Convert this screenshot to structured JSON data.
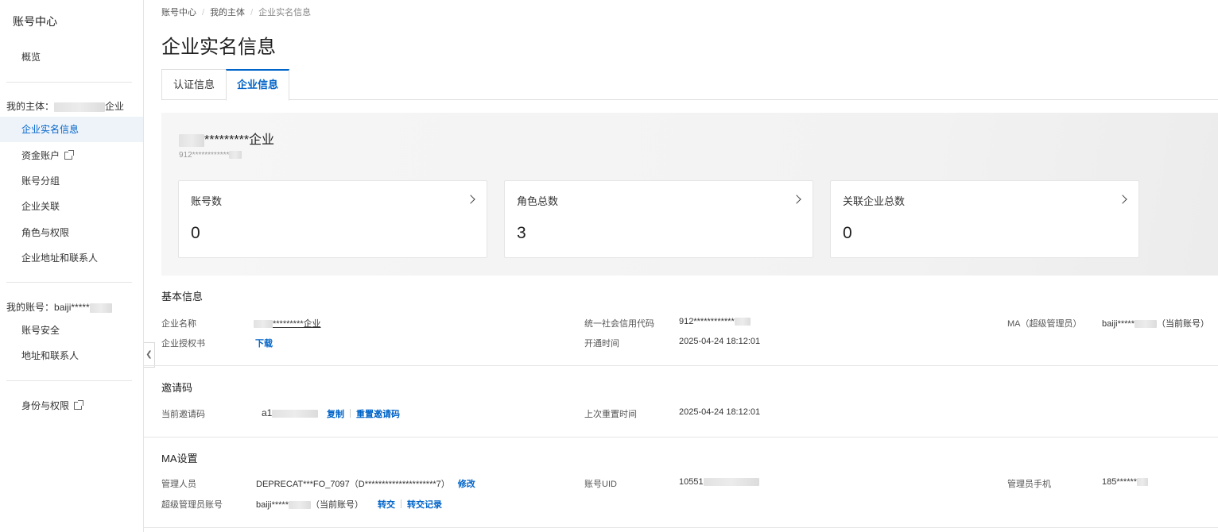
{
  "sidebar": {
    "title": "账号中心",
    "overview": "概览",
    "my_entity_label": "我的主体：",
    "my_entity_suffix": "企业",
    "entity_items": [
      "企业实名信息",
      "资金账户",
      "账号分组",
      "企业关联",
      "角色与权限",
      "企业地址和联系人"
    ],
    "my_account_label": "我的账号：",
    "my_account_value": "baiji*****",
    "account_items": [
      "账号安全",
      "地址和联系人"
    ],
    "identity": "身份与权限"
  },
  "breadcrumb": [
    "账号中心",
    "我的主体",
    "企业实名信息"
  ],
  "page_title": "企业实名信息",
  "tabs": [
    "认证信息",
    "企业信息"
  ],
  "summary": {
    "name": "*********企业",
    "code": "912************",
    "cards": [
      {
        "label": "账号数",
        "value": "0"
      },
      {
        "label": "角色总数",
        "value": "3"
      },
      {
        "label": "关联企业总数",
        "value": "0"
      }
    ]
  },
  "basic": {
    "title": "基本信息",
    "company_name_label": "企业名称",
    "company_name_value": "*********企业",
    "credit_code_label": "统一社会信用代码",
    "credit_code_value": "912************",
    "ma_label": "MA（超级管理员）",
    "ma_value": "baiji*****",
    "ma_suffix": "（当前账号）",
    "auth_letter_label": "企业授权书",
    "auth_letter_link": "下载",
    "open_time_label": "开通时间",
    "open_time_value": "2025-04-24 18:12:01"
  },
  "invite": {
    "title": "邀请码",
    "current_label": "当前邀请码",
    "current_value": "a1",
    "copy": "复制",
    "reset": "重置邀请码",
    "last_reset_label": "上次重置时间",
    "last_reset_value": "2025-04-24 18:12:01"
  },
  "ma": {
    "title": "MA设置",
    "admin_label": "管理人员",
    "admin_value": "DEPRECAT***FO_7097（D*********************7）",
    "admin_edit": "修改",
    "uid_label": "账号UID",
    "uid_value": "10551",
    "phone_label": "管理员手机",
    "phone_value": "185******",
    "super_label": "超级管理员账号",
    "super_value": "baiji*****",
    "super_suffix": "（当前账号）",
    "transfer": "转交",
    "transfer_log": "转交记录"
  },
  "colors": {
    "accent": "#0064c8",
    "active_bg": "#eef3fa"
  }
}
